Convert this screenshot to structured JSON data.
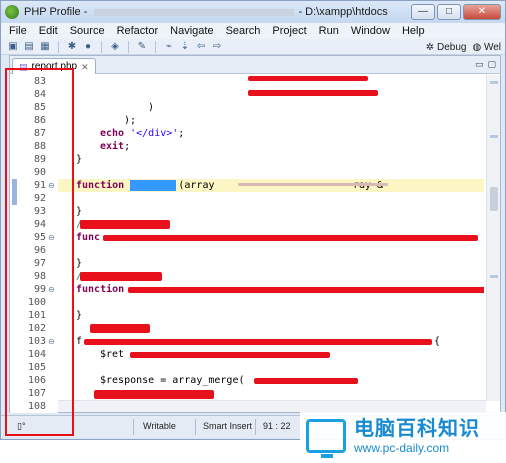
{
  "window": {
    "title_prefix": "PHP Profile - ",
    "title_suffix": "- D:\\xampp\\htdocs",
    "buttons": {
      "minimize": "—",
      "maximize": "□",
      "close": "✕"
    }
  },
  "menu": [
    "File",
    "Edit",
    "Source",
    "Refactor",
    "Navigate",
    "Search",
    "Project",
    "Run",
    "Window",
    "Help"
  ],
  "toolbar": {
    "perspective_debug": "Debug",
    "perspective_web": "Wel"
  },
  "editor": {
    "tab_label": "report.php",
    "lines": [
      {
        "n": "83",
        "fold": ""
      },
      {
        "n": "84",
        "fold": ""
      },
      {
        "n": "85",
        "fold": ""
      },
      {
        "n": "86",
        "fold": ""
      },
      {
        "n": "87",
        "fold": ""
      },
      {
        "n": "88",
        "fold": ""
      },
      {
        "n": "89",
        "fold": ""
      },
      {
        "n": "90",
        "fold": ""
      },
      {
        "n": "91",
        "fold": "⊖"
      },
      {
        "n": "92",
        "fold": ""
      },
      {
        "n": "93",
        "fold": ""
      },
      {
        "n": "94",
        "fold": ""
      },
      {
        "n": "95",
        "fold": "⊖"
      },
      {
        "n": "96",
        "fold": ""
      },
      {
        "n": "97",
        "fold": ""
      },
      {
        "n": "98",
        "fold": ""
      },
      {
        "n": "99",
        "fold": "⊖"
      },
      {
        "n": "100",
        "fold": ""
      },
      {
        "n": "101",
        "fold": ""
      },
      {
        "n": "102",
        "fold": ""
      },
      {
        "n": "103",
        "fold": "⊖"
      },
      {
        "n": "104",
        "fold": ""
      },
      {
        "n": "105",
        "fold": ""
      },
      {
        "n": "106",
        "fold": ""
      },
      {
        "n": "107",
        "fold": ""
      },
      {
        "n": "108",
        "fold": ""
      }
    ],
    "code": {
      "l85": ")",
      "l86": ");",
      "l87_kw": "echo",
      "l87_str": "'</div>'",
      "l87_end": ";",
      "l88_kw": "exit",
      "l88_end": ";",
      "l89": "}",
      "l91_kw": "function",
      "l91_rest": "(array",
      "l91_tail": "ray &",
      "l93": "}",
      "l94": "/",
      "l95_kw": "func",
      "l97": "}",
      "l98": "/",
      "l99_kw": "function",
      "l101": "}",
      "l103": "f",
      "l103_end": "{",
      "l104": "$ret",
      "l106": "$response = array_merge(",
      "l108": "}"
    }
  },
  "status": {
    "writable": "Writable",
    "insert_mode": "Smart Insert",
    "position": "91 : 22"
  },
  "watermark": {
    "main": "电脑百科知识",
    "url": "www.pc-daily.com"
  }
}
